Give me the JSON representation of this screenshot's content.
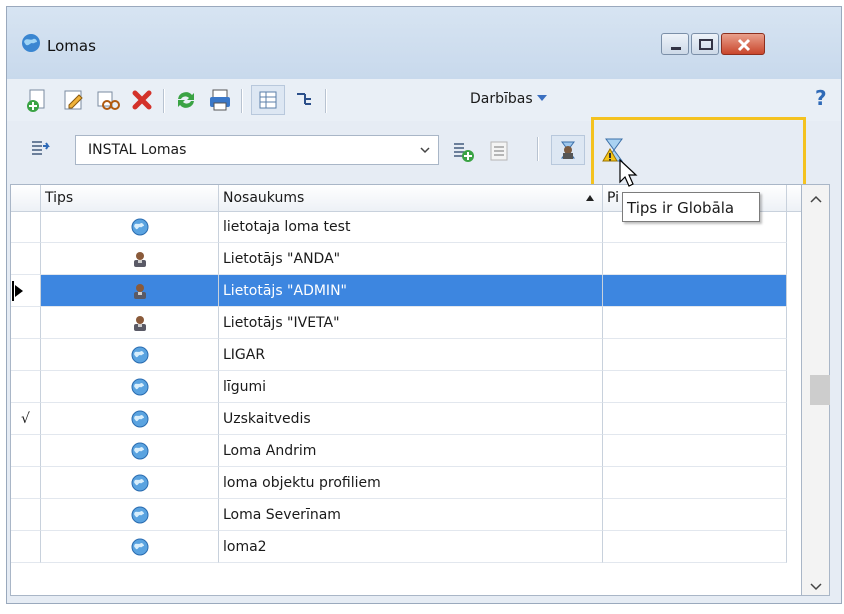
{
  "window": {
    "title": "Lomas"
  },
  "toolbar": {
    "actions_label": "Darbības"
  },
  "filter": {
    "selected": "INSTAL Lomas"
  },
  "table": {
    "columns": [
      "Tips",
      "Nosaukums",
      "Pi"
    ],
    "rows": [
      {
        "check": "",
        "type": "globe",
        "name": "lietotaja loma test"
      },
      {
        "check": "",
        "type": "user",
        "name": "Lietotājs \"ANDA\""
      },
      {
        "check": "",
        "type": "user",
        "name": "Lietotājs \"ADMIN\"",
        "selected": true
      },
      {
        "check": "",
        "type": "user",
        "name": "Lietotājs \"IVETA\""
      },
      {
        "check": "",
        "type": "globe",
        "name": "LIGAR"
      },
      {
        "check": "",
        "type": "globe",
        "name": "līgumi"
      },
      {
        "check": "√",
        "type": "globe",
        "name": "Uzskaitvedis"
      },
      {
        "check": "",
        "type": "globe",
        "name": "Loma Andrim"
      },
      {
        "check": "",
        "type": "globe",
        "name": "loma objektu profiliem"
      },
      {
        "check": "",
        "type": "globe",
        "name": "Loma Severīnam"
      },
      {
        "check": "",
        "type": "globe",
        "name": "loma2"
      }
    ]
  },
  "tooltip": {
    "text": "Tips ir Globāla"
  },
  "colors": {
    "selection": "#3d86e0",
    "highlight": "#f4c21f",
    "close": "#c9462c"
  }
}
